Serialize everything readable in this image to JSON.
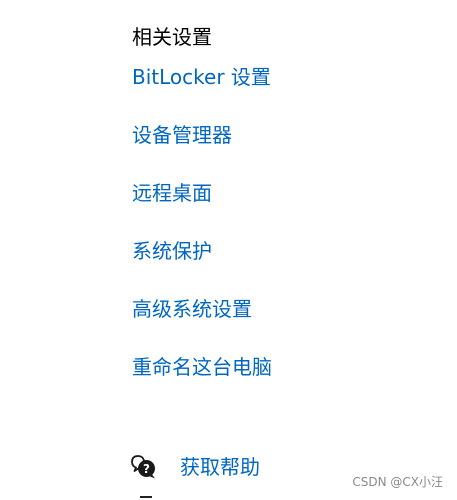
{
  "related_settings": {
    "title": "相关设置",
    "links": [
      {
        "label": "BitLocker 设置"
      },
      {
        "label": "设备管理器"
      },
      {
        "label": "远程桌面"
      },
      {
        "label": "系统保护"
      },
      {
        "label": "高级系统设置"
      },
      {
        "label": "重命名这台电脑"
      }
    ]
  },
  "help": {
    "label": "获取帮助",
    "icon": "chat-help-icon"
  },
  "watermark": "CSDN @CX小汪",
  "colors": {
    "link": "#0067c0",
    "text": "#000000",
    "background": "#ffffff"
  }
}
